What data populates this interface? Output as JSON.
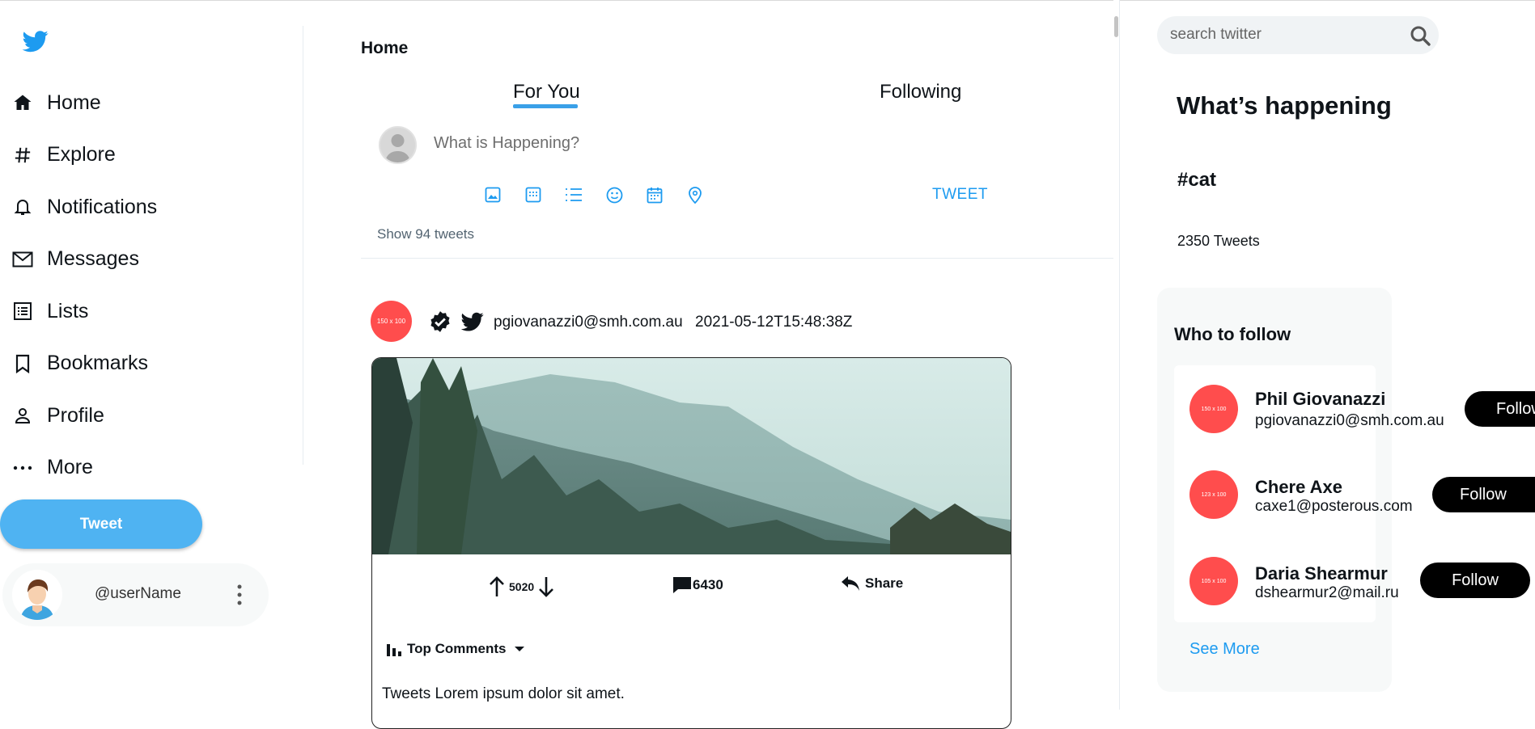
{
  "sidebar": {
    "items": [
      {
        "label": "Home",
        "icon": "home-icon"
      },
      {
        "label": "Explore",
        "icon": "hashtag-icon"
      },
      {
        "label": "Notifications",
        "icon": "bell-icon"
      },
      {
        "label": "Messages",
        "icon": "mail-icon"
      },
      {
        "label": "Lists",
        "icon": "list-icon"
      },
      {
        "label": "Bookmarks",
        "icon": "bookmark-icon"
      },
      {
        "label": "Profile",
        "icon": "person-icon"
      },
      {
        "label": "More",
        "icon": "more-dots-icon"
      }
    ],
    "tweet_button": "Tweet",
    "user": {
      "handle": "@userName"
    }
  },
  "main": {
    "title": "Home",
    "tabs": [
      {
        "label": "For You"
      },
      {
        "label": "Following"
      }
    ],
    "compose": {
      "placeholder": "What is Happening?",
      "tweet_label": "TWEET"
    },
    "show_tweets": "Show 94 tweets",
    "post": {
      "avatar_text": "150 x 100",
      "author": "pgiovanazzi0@smh.com.au",
      "timestamp": "2021-05-12T15:48:38Z",
      "votes": "5020",
      "comments": "6430",
      "share_label": "Share",
      "sort_label": "Top Comments",
      "text": "Tweets Lorem ipsum dolor sit amet."
    }
  },
  "right": {
    "search_placeholder": "search twitter",
    "happening_title": "What’s happening",
    "trend": {
      "tag": "#cat",
      "count": "2350 Tweets"
    },
    "who_to_follow_title": "Who to follow",
    "follow_list": [
      {
        "name": "Phil Giovanazzi",
        "handle": "pgiovanazzi0@smh.com.au",
        "avatar_text": "150 x 100",
        "button": "Follow"
      },
      {
        "name": "Chere Axe",
        "handle": "caxe1@posterous.com",
        "avatar_text": "123 x 100",
        "button": "Follow"
      },
      {
        "name": "Daria Shearmur",
        "handle": "dshearmur2@mail.ru",
        "avatar_text": "105 x 100",
        "button": "Follow"
      }
    ],
    "see_more": "See More"
  },
  "colors": {
    "accent": "#1d9bf0",
    "tweet_button": "#4fb3f2",
    "avatar_red": "#ff4d4d"
  }
}
